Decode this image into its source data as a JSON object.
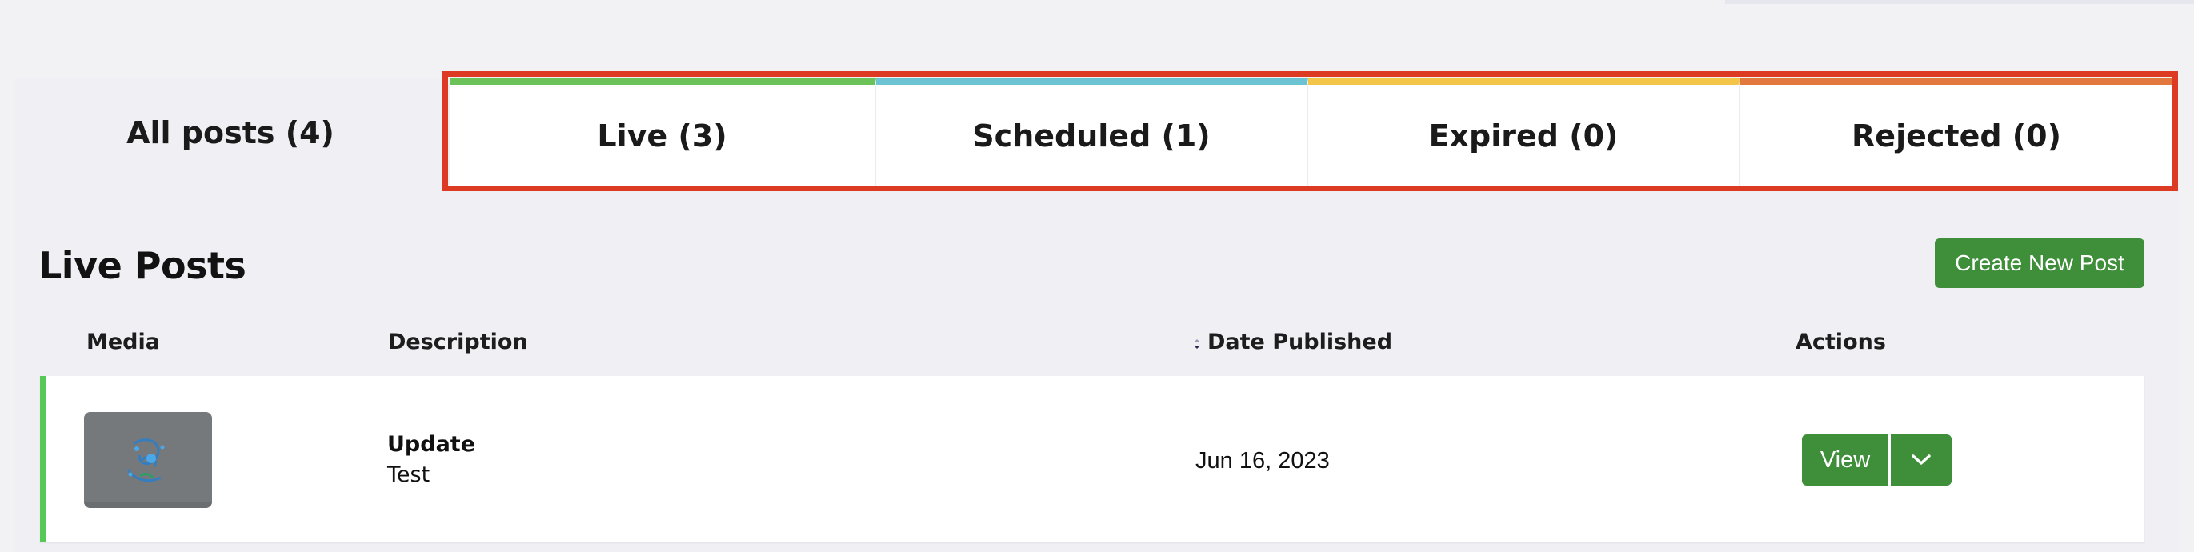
{
  "tabs": {
    "all": "All posts (4)",
    "live": "Live (3)",
    "scheduled": "Scheduled (1)",
    "expired": "Expired (0)",
    "rejected": "Rejected (0)"
  },
  "tab_colors": {
    "live": "#6ac259",
    "scheduled": "#6cc4d2",
    "expired": "#f3c64a",
    "rejected": "#e3783e",
    "highlight": "#dd3a24"
  },
  "section": {
    "title": "Live Posts",
    "create_button": "Create New Post"
  },
  "table": {
    "headers": {
      "media": "Media",
      "description": "Description",
      "date": "Date Published",
      "actions": "Actions"
    },
    "rows": [
      {
        "title": "Update",
        "subtitle": "Test",
        "date": "Jun 16, 2023",
        "view_label": "View",
        "media_icon": "thumbnail-image"
      }
    ]
  },
  "accent_color": "#3e8e3a",
  "icons": {
    "sort": "sort-icon",
    "dropdown": "chevron-down-icon"
  }
}
